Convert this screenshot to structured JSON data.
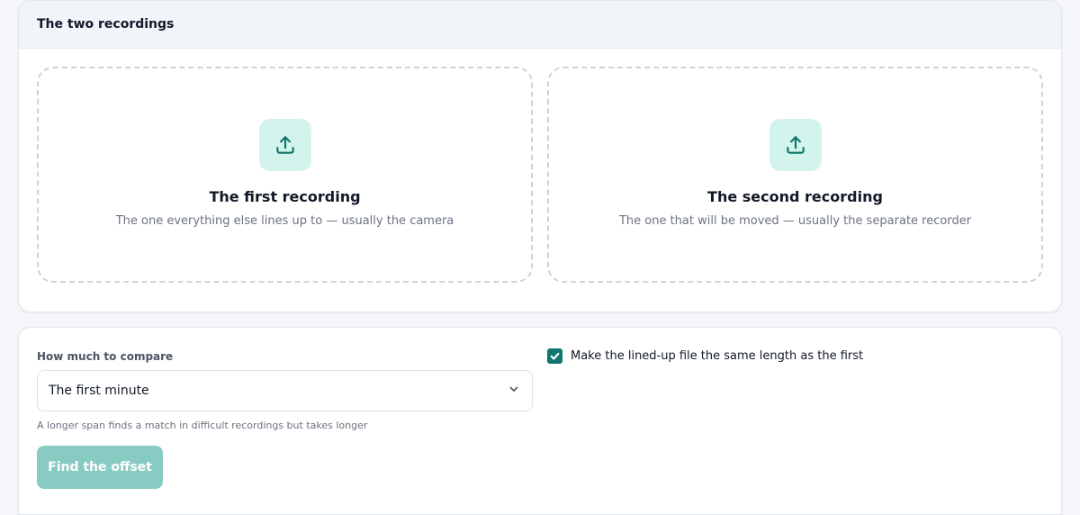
{
  "recordings": {
    "header": "The two recordings",
    "first": {
      "icon": "upload-icon",
      "title": "The first recording",
      "subtitle": "The one everything else lines up to — usually the camera"
    },
    "second": {
      "icon": "upload-icon",
      "title": "The second recording",
      "subtitle": "The one that will be moved — usually the separate recorder"
    }
  },
  "options": {
    "compare_label": "How much to compare",
    "compare_value": "The first minute",
    "compare_hint": "A longer span finds a match in difficult recordings but takes longer",
    "find_button": "Find the offset",
    "same_length_label": "Make the lined-up file the same length as the first",
    "same_length_checked": true
  },
  "colors": {
    "accent": "#0f766e",
    "icon_tile": "#d3f4ec",
    "button_disabled": "#88cbc2"
  }
}
